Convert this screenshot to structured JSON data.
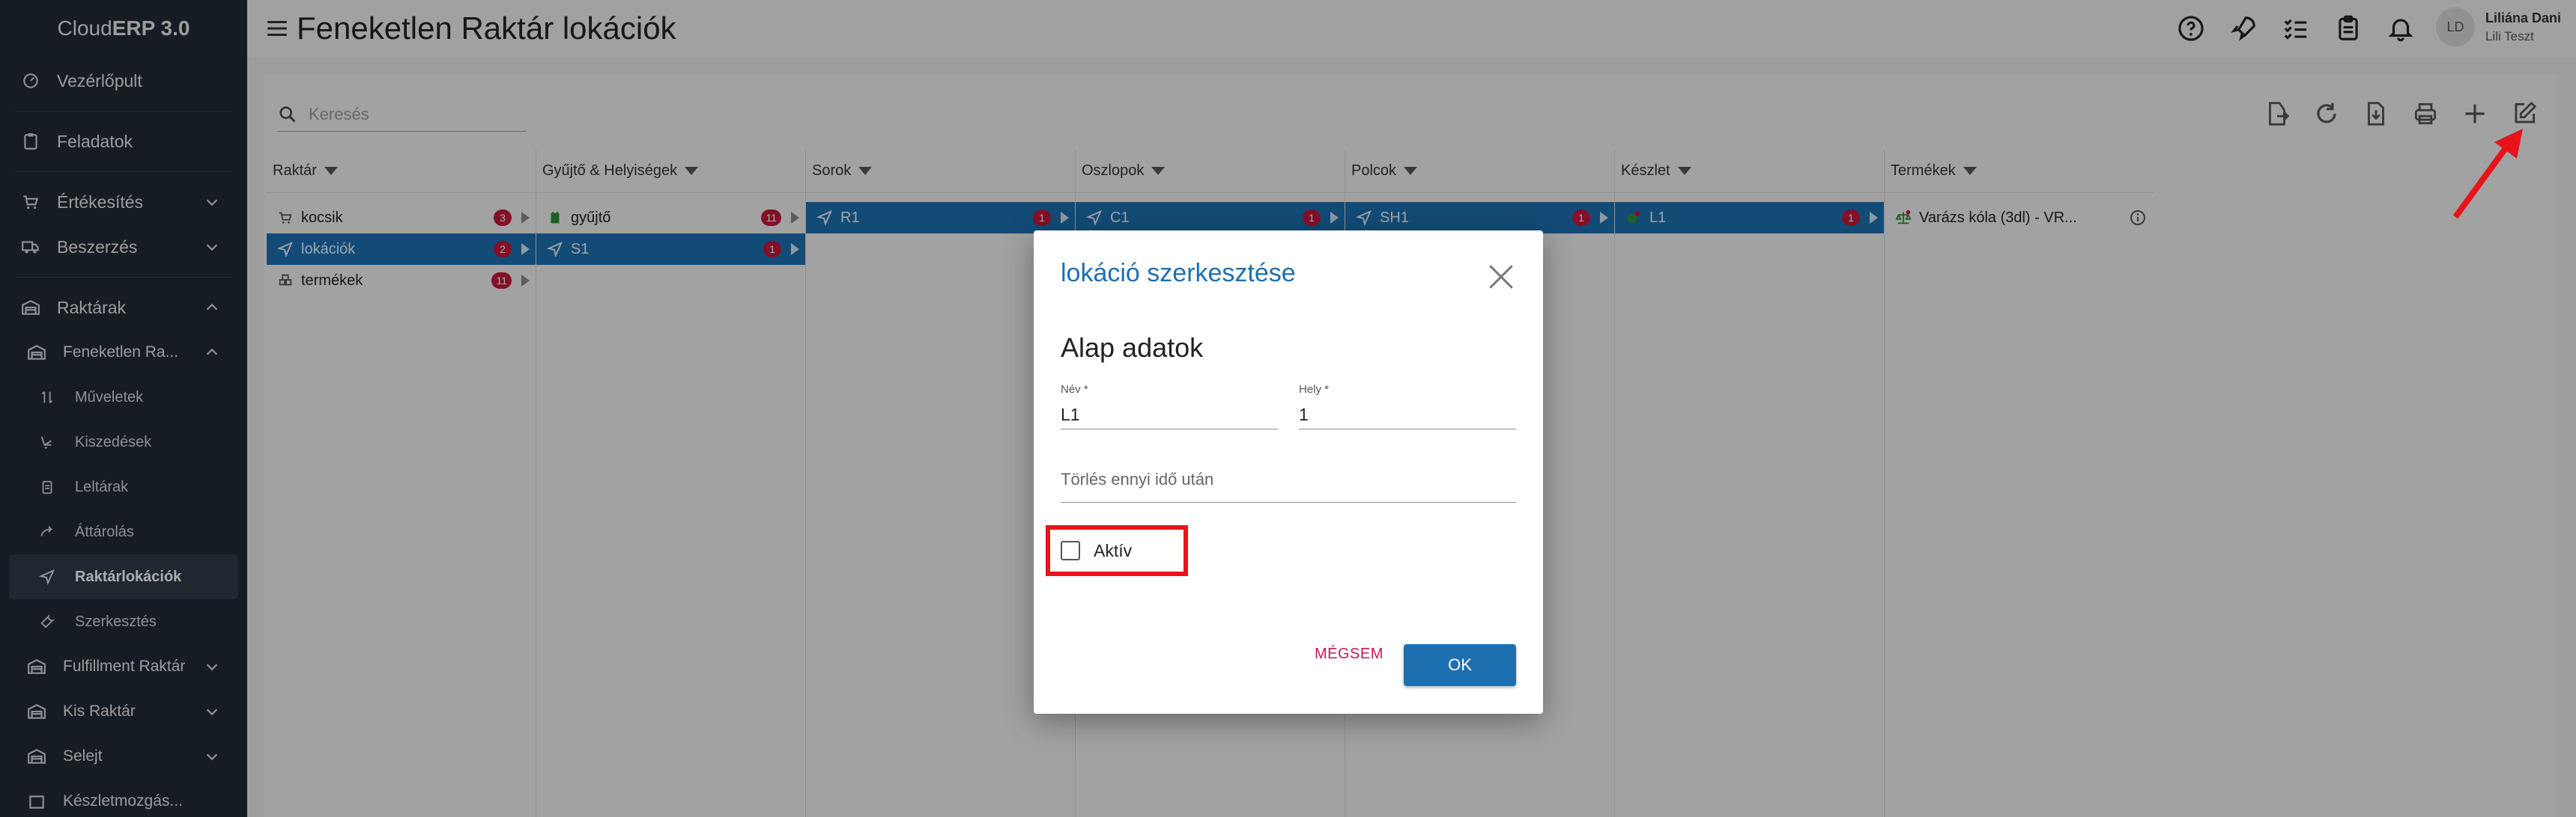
{
  "app": {
    "brand_prefix": "Cloud",
    "brand_bold": "ERP 3.0"
  },
  "header": {
    "title": "Feneketlen Raktár lokációk"
  },
  "user": {
    "initials": "LD",
    "name": "Liliána Dani",
    "org": "Lili Teszt"
  },
  "sidebar": {
    "items": [
      {
        "label": "Vezérlőpult",
        "icon": "dashboard-icon"
      },
      {
        "label": "Feladatok",
        "icon": "clipboard-icon"
      },
      {
        "label": "Értékesítés",
        "icon": "cart-icon"
      },
      {
        "label": "Beszerzés",
        "icon": "truck-icon"
      },
      {
        "label": "Raktárak",
        "icon": "warehouse-icon"
      },
      {
        "label": "Feneketlen Ra...",
        "icon": "warehouse-icon"
      },
      {
        "label": "Műveletek",
        "icon": "swap-icon"
      },
      {
        "label": "Kiszedések",
        "icon": "cart-picking-icon"
      },
      {
        "label": "Leltárak",
        "icon": "clipboard-list-icon"
      },
      {
        "label": "Áttárolás",
        "icon": "transfer-icon"
      },
      {
        "label": "Raktárlokációk",
        "icon": "location-arrow-icon"
      },
      {
        "label": "Szerkesztés",
        "icon": "wrench-icon"
      },
      {
        "label": "Fulfillment Raktár",
        "icon": "warehouse-icon"
      },
      {
        "label": "Kis Raktár",
        "icon": "warehouse-icon"
      },
      {
        "label": "Selejt",
        "icon": "warehouse-icon"
      },
      {
        "label": "Készletmozgás...",
        "icon": "box-icon"
      }
    ]
  },
  "search": {
    "placeholder": "Keresés"
  },
  "columns": [
    {
      "header": "Raktár"
    },
    {
      "header": "Gyűjtő & Helyiségek"
    },
    {
      "header": "Sorok"
    },
    {
      "header": "Oszlopok"
    },
    {
      "header": "Polcok"
    },
    {
      "header": "Készlet"
    },
    {
      "header": "Termékek"
    }
  ],
  "rows": {
    "raktar": [
      {
        "label": "kocsik",
        "badge": "3"
      },
      {
        "label": "lokációk",
        "badge": "2"
      },
      {
        "label": "termékek",
        "badge": "11"
      }
    ],
    "gyujto": [
      {
        "label": "gyűjtő",
        "badge": "11"
      },
      {
        "label": "S1",
        "badge": "1"
      }
    ],
    "sorok": [
      {
        "label": "R1",
        "badge": "1"
      }
    ],
    "oszlopok": [
      {
        "label": "C1",
        "badge": "1"
      }
    ],
    "polcok": [
      {
        "label": "SH1",
        "badge": "1"
      }
    ],
    "keszlet": [
      {
        "label": "L1",
        "badge": "1"
      }
    ],
    "termekek": [
      {
        "label": "Varázs kóla (3dl) - VR..."
      }
    ]
  },
  "dialog": {
    "title": "lokáció szerkesztése",
    "section": "Alap adatok",
    "name_label": "Név *",
    "name_value": "L1",
    "place_label": "Hely *",
    "place_value": "1",
    "delete_after_placeholder": "Törlés ennyi idő után",
    "active_label": "Aktív",
    "active_checked": false,
    "cancel_label": "MÉGSEM",
    "ok_label": "OK"
  },
  "colors": {
    "accent": "#1d6fb0",
    "badge": "#c2173b",
    "sidebar": "#1f2a34",
    "highlight": "#e8141b"
  }
}
